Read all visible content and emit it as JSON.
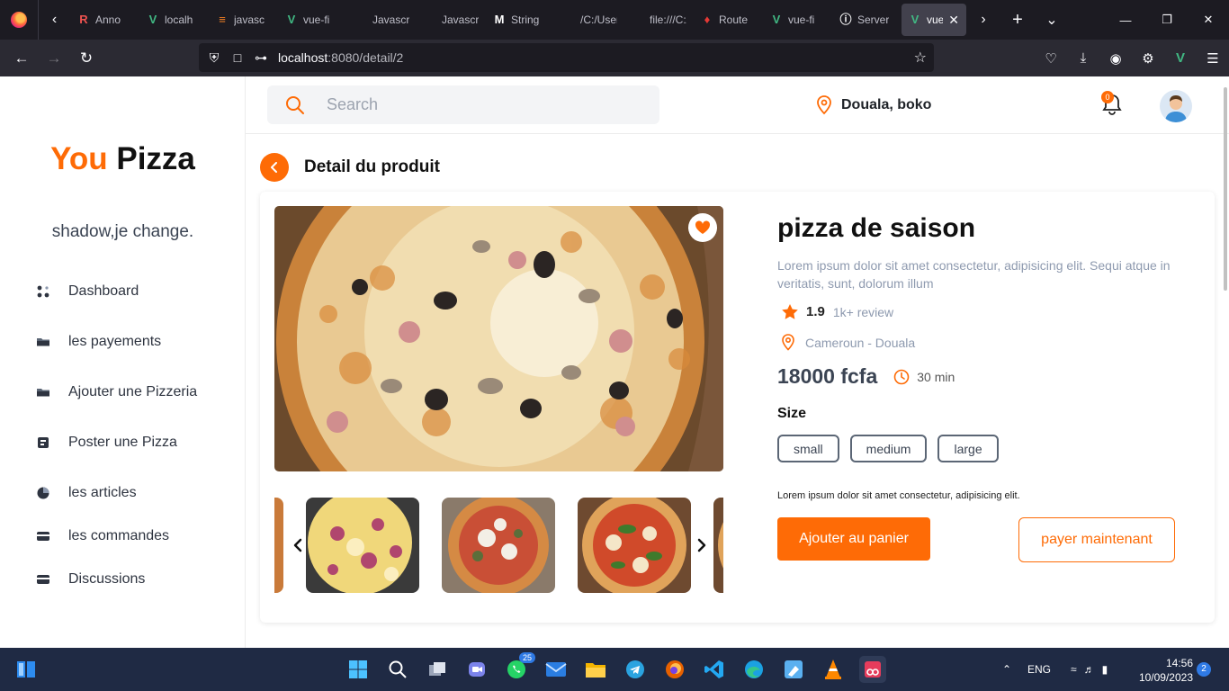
{
  "browser": {
    "tabs": [
      {
        "title": "Anno",
        "icon": "raccoon-icon",
        "glyph": "R",
        "color": "#ef5350"
      },
      {
        "title": "localh",
        "icon": "vue-icon",
        "glyph": "V",
        "color": "#41b883"
      },
      {
        "title": "javasc",
        "icon": "stackoverflow-icon",
        "glyph": "≡",
        "color": "#f48024"
      },
      {
        "title": "vue-fi",
        "icon": "vue-icon",
        "glyph": "V",
        "color": "#41b883"
      },
      {
        "title": "Javascript",
        "icon": "",
        "glyph": "",
        "color": "#bfbfc9"
      },
      {
        "title": "Javascript",
        "icon": "",
        "glyph": "",
        "color": "#bfbfc9"
      },
      {
        "title": "String",
        "icon": "mdn-icon",
        "glyph": "M",
        "color": "#ffffff"
      },
      {
        "title": "/C:/Users/",
        "icon": "",
        "glyph": "",
        "color": "#bfbfc9"
      },
      {
        "title": "file:///C:/",
        "icon": "",
        "glyph": "",
        "color": "#bfbfc9"
      },
      {
        "title": "Route",
        "icon": "router-icon",
        "glyph": "♦",
        "color": "#e53935"
      },
      {
        "title": "vue-fi",
        "icon": "vue-icon",
        "glyph": "V",
        "color": "#41b883"
      },
      {
        "title": "Server",
        "icon": "info-icon",
        "glyph": "ⓘ",
        "color": "#ffffff"
      }
    ],
    "active_tab": {
      "title": "vue",
      "icon": "vue-icon",
      "glyph": "V",
      "color": "#41b883"
    },
    "url_host": "localhost",
    "url_rest": ":8080/detail/2"
  },
  "sidebar": {
    "logo_you": "You",
    "logo_pizza": "Pizza",
    "tagline": "shadow,je change.",
    "items": [
      {
        "label": "Dashboard",
        "icon": "dashboard-icon"
      },
      {
        "label": "les payements",
        "icon": "folder-icon"
      },
      {
        "label": "Ajouter une Pizzeria",
        "icon": "folder-icon"
      },
      {
        "label": "Poster une Pizza",
        "icon": "card-icon"
      },
      {
        "label": "les articles",
        "icon": "pie-chart-icon"
      },
      {
        "label": "les commandes",
        "icon": "credit-card-icon"
      },
      {
        "label": "Discussions",
        "icon": "credit-card-icon"
      }
    ]
  },
  "topbar": {
    "search_placeholder": "Search",
    "location": "Douala, boko",
    "notification_count": "0"
  },
  "detail": {
    "title": "Detail du produit",
    "name": "pizza de saison",
    "description": "Lorem ipsum dolor sit amet consectetur, adipisicing elit. Sequi atque in veritatis, sunt, dolorum illum",
    "rating": "1.9",
    "reviews": "1k+ review",
    "location": "Cameroun - Douala",
    "price": "18000 fcfa",
    "time": "30 min",
    "size_label": "Size",
    "sizes": [
      "small",
      "medium",
      "large"
    ],
    "note": "Lorem ipsum dolor sit amet consectetur, adipisicing elit.",
    "add_to_cart": "Ajouter au panier",
    "pay_now": "payer maintenant"
  },
  "colors": {
    "accent": "#fe6b06",
    "text_muted": "#8e9aaf",
    "dark": "#3b4453"
  },
  "taskbar": {
    "whatsapp_badge": "25",
    "lang": "ENG",
    "time": "14:56",
    "date": "10/09/2023",
    "notifications": "2"
  }
}
